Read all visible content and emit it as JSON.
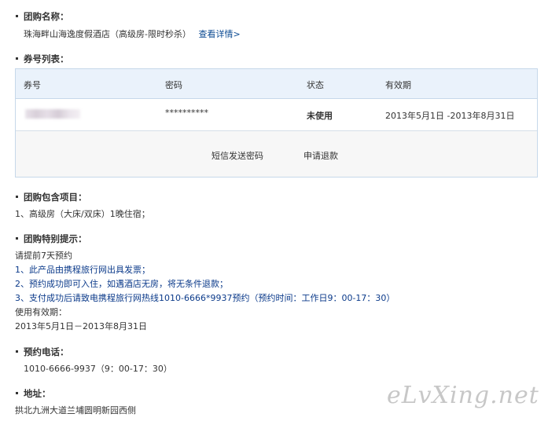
{
  "deal_name": {
    "heading": "团购名称：",
    "value": "珠海畔山海逸度假酒店（高级房-限时秒杀）",
    "details_link": "查看详情>"
  },
  "voucher_list": {
    "heading": "券号列表：",
    "columns": [
      "券号",
      "密码",
      "状态",
      "有效期"
    ],
    "rows": [
      {
        "code": "",
        "password": "**********",
        "status": "未使用",
        "validity": "2013年5月1日 -2013年8月31日"
      }
    ],
    "actions": {
      "sms": "短信发送密码",
      "refund": "申请退款"
    }
  },
  "package": {
    "heading": "团购包含项目：",
    "items": [
      "1、高级房（大床/双床）1晚住宿；"
    ]
  },
  "tips": {
    "heading": "团购特别提示：",
    "lines": [
      "请提前7天预约",
      "1、此产品由携程旅行网出具发票；",
      "2、预约成功即可入住，如遇酒店无房，将无条件退款；",
      "3、支付成功后请致电携程旅行网热线1010-6666*9937预约（预约时间：工作日9：00-17：30）",
      "使用有效期：",
      "2013年5月1日－2013年8月31日"
    ]
  },
  "booking_phone": {
    "heading": "预约电话：",
    "value": "1010-6666-9937（9：00-17：30）"
  },
  "address": {
    "heading": "地址：",
    "value": "拱北九洲大道兰埔圆明新园西侧"
  },
  "watermark": "eLvXing.net"
}
